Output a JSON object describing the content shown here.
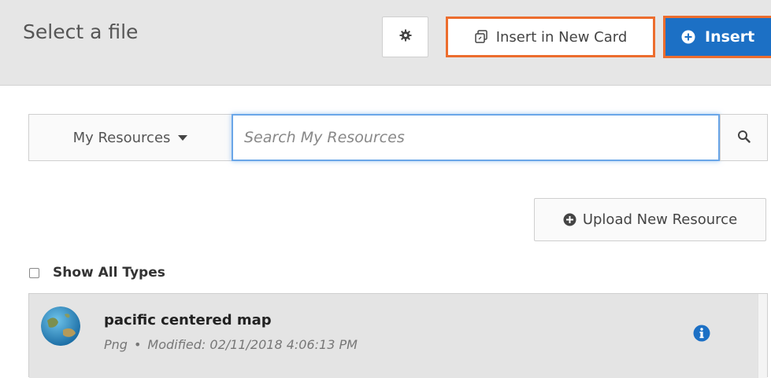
{
  "header": {
    "title": "Select a file",
    "settings_icon": "gear-icon",
    "insert_new_card_label": "Insert in New Card",
    "insert_label": "Insert"
  },
  "search": {
    "resources_dropdown": "My Resources",
    "placeholder": "Search My Resources",
    "value": ""
  },
  "upload": {
    "label": "Upload New Resource"
  },
  "filter": {
    "show_all_types_label": "Show All Types",
    "checked": false
  },
  "files": [
    {
      "title": "pacific centered map",
      "type": "Png",
      "modified": "Modified: 02/11/2018 4:06:13 PM"
    }
  ],
  "colors": {
    "primary": "#1c70c5",
    "highlight": "#ec6d2e",
    "info": "#1c70c5"
  }
}
